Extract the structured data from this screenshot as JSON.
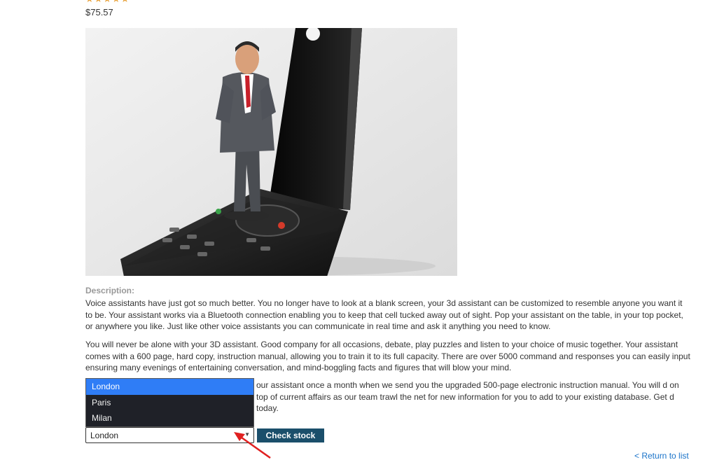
{
  "product": {
    "rating_display": "★★★★★",
    "price": "$75.57",
    "image_icon": "product-photo",
    "description_heading": "Description:",
    "paragraphs": [
      "Voice assistants have just got so much better. You no longer have to look at a blank screen, your 3d assistant can be customized to resemble anyone you want it to be. Your assistant works via a Bluetooth connection enabling you to keep that cell tucked away out of sight. Pop your assistant on the table, in your top pocket, or anywhere you like. Just like other voice assistants you can communicate in real time and ask it anything you need to know.",
      "You will never be alone with your 3D assistant. Good company for all occasions, debate, play puzzles and listen to your choice of music together. Your assistant comes with a 600 page, hard copy, instruction manual, allowing you to train it to its full capacity. There are over 5000 command and responses you can easily input ensuring many evenings of entertaining conversation, and mind-boggling facts and figures that will blow your mind.",
      "our assistant once a month when we send you the upgraded 500-page electronic instruction manual. You will d on top of current affairs as our team trawl the net for new information for you to add to your existing database. Get d today."
    ]
  },
  "stock": {
    "selected": "London",
    "options": [
      "London",
      "Paris",
      "Milan"
    ],
    "button_label": "Check stock"
  },
  "nav": {
    "return_label": "< Return to list"
  },
  "colors": {
    "accent": "#1b4f6b",
    "link": "#1a73c9",
    "highlight": "#2f7df6",
    "annotation": "#e02020"
  }
}
